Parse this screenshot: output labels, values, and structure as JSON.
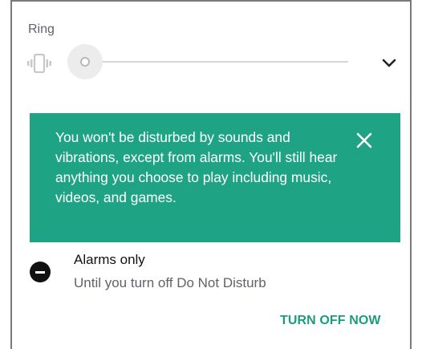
{
  "ring": {
    "label": "Ring",
    "level": 0,
    "vibrate_icon": "vibrate-icon",
    "expand_icon": "chevron-down-icon"
  },
  "banner": {
    "message": "You won't be disturbed by sounds and vibrations, except from alarms. You'll still hear anything you choose to play including music, videos, and games.",
    "close_icon": "close-icon",
    "background_color": "#1fa385"
  },
  "mode": {
    "icon": "do-not-disturb-icon",
    "title": "Alarms only",
    "subtitle": "Until you turn off Do Not Disturb"
  },
  "actions": {
    "turn_off_label": "TURN OFF NOW",
    "accent_color": "#1b9c7f"
  }
}
